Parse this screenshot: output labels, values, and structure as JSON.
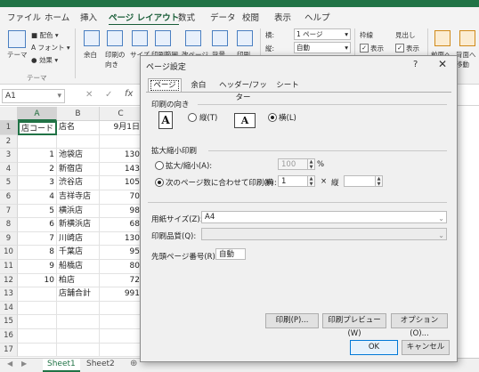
{
  "menu": [
    "ファイル",
    "ホーム",
    "挿入",
    "ページ レイアウト",
    "数式",
    "データ",
    "校閲",
    "表示",
    "ヘルプ"
  ],
  "ribbon": {
    "theme_group": {
      "theme": "テーマ",
      "colors": "配色",
      "fonts": "フォント",
      "effects": "効果",
      "group_label": "テーマ"
    },
    "buttons": [
      "余白",
      "印刷の\n向き",
      "サイズ",
      "印刷範囲",
      "改ページ",
      "背景",
      "印刷"
    ],
    "scale": {
      "width_label": "横:",
      "width_value": "1 ページ",
      "height_label": "縦:",
      "height_value": "自動"
    },
    "gridlines": {
      "label": "枠線",
      "view": "表示"
    },
    "headings": {
      "label": "見出し",
      "view": "表示"
    },
    "arrange": [
      "前面へ",
      "背面へ\n移動"
    ]
  },
  "namebox": "A1",
  "columns": [
    "A",
    "B",
    "C"
  ],
  "rows": [
    {
      "n": "1",
      "a": "店コード",
      "b": "店名",
      "c": "9月1日"
    },
    {
      "n": "2",
      "a": "",
      "b": "",
      "c": ""
    },
    {
      "n": "3",
      "a": "1",
      "b": "池袋店",
      "c": "130"
    },
    {
      "n": "4",
      "a": "2",
      "b": "新宿店",
      "c": "143"
    },
    {
      "n": "5",
      "a": "3",
      "b": "渋谷店",
      "c": "105"
    },
    {
      "n": "6",
      "a": "4",
      "b": "吉祥寺店",
      "c": "70"
    },
    {
      "n": "7",
      "a": "5",
      "b": "横浜店",
      "c": "98"
    },
    {
      "n": "8",
      "a": "6",
      "b": "新横浜店",
      "c": "68"
    },
    {
      "n": "9",
      "a": "7",
      "b": "川崎店",
      "c": "130"
    },
    {
      "n": "10",
      "a": "8",
      "b": "千葉店",
      "c": "95"
    },
    {
      "n": "11",
      "a": "9",
      "b": "船橋店",
      "c": "80"
    },
    {
      "n": "12",
      "a": "10",
      "b": "柏店",
      "c": "72"
    },
    {
      "n": "13",
      "a": "",
      "b": "店舗合計",
      "c": "991"
    },
    {
      "n": "14",
      "a": "",
      "b": "",
      "c": ""
    },
    {
      "n": "15",
      "a": "",
      "b": "",
      "c": ""
    },
    {
      "n": "16",
      "a": "",
      "b": "",
      "c": ""
    },
    {
      "n": "17",
      "a": "",
      "b": "",
      "c": ""
    }
  ],
  "sheets": [
    "Sheet1",
    "Sheet2"
  ],
  "dialog": {
    "title": "ページ設定",
    "help": "?",
    "close": "✕",
    "tabs": [
      "ページ",
      "余白",
      "ヘッダー/フッター",
      "シート"
    ],
    "orientation": {
      "section": "印刷の向き",
      "portrait": "縦(T)",
      "landscape": "横(L)",
      "selected": "landscape"
    },
    "scaling": {
      "section": "拡大縮小印刷",
      "adjust_label": "拡大/縮小(A):",
      "adjust_value": "100",
      "percent": "%",
      "fit_label": "次のページ数に合わせて印刷(F):",
      "wide_label": "横",
      "wide_value": "1",
      "times": "×",
      "tall_label": "縦",
      "tall_value": ""
    },
    "paper_size_label": "用紙サイズ(Z):",
    "paper_size_value": "A4",
    "print_quality_label": "印刷品質(Q):",
    "print_quality_value": "",
    "first_page_label": "先頭ページ番号(R):",
    "first_page_value": "自動",
    "print_button": "印刷(P)...",
    "preview_button": "印刷プレビュー(W)",
    "options_button": "オプション(O)...",
    "ok_button": "OK",
    "cancel_button": "キャンセル"
  }
}
